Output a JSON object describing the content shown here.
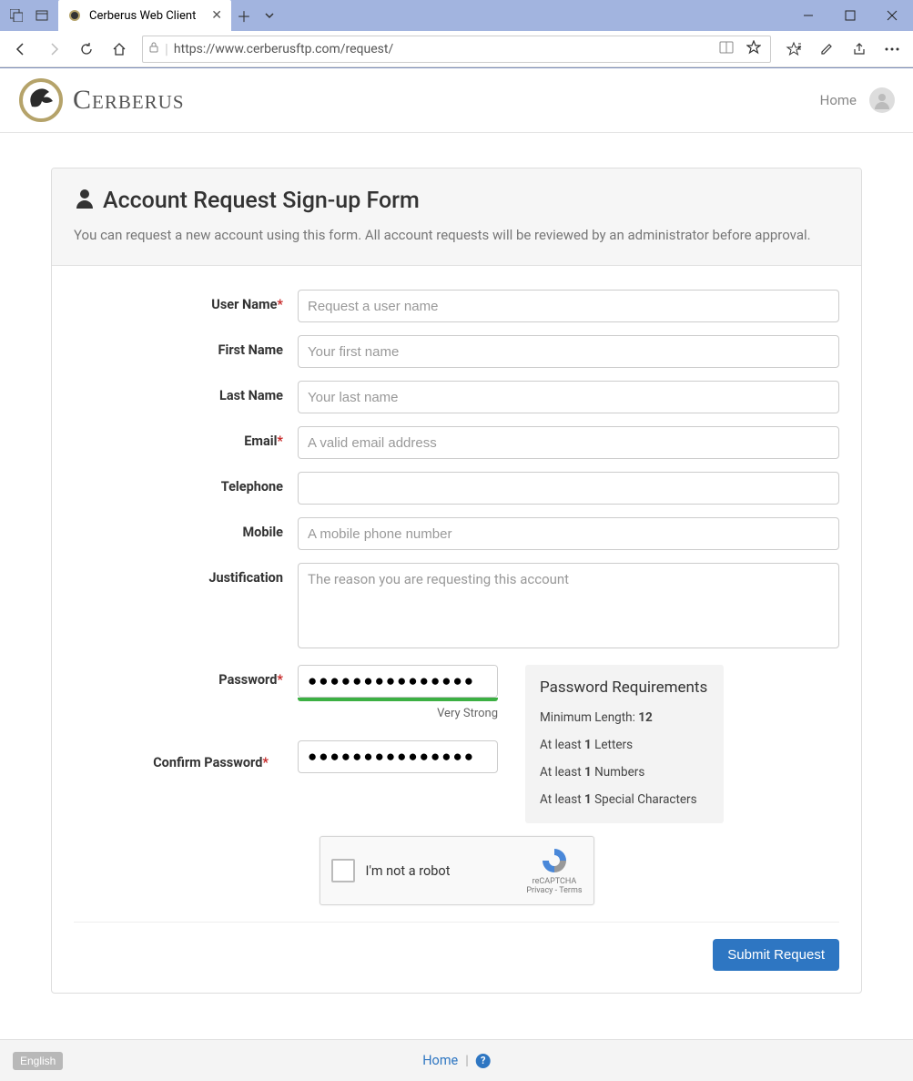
{
  "browser": {
    "tab_title": "Cerberus Web Client",
    "url": "https://www.cerberusftp.com/request/"
  },
  "header": {
    "brand": "Cerberus",
    "home_link": "Home"
  },
  "panel": {
    "title": "Account Request Sign-up Form",
    "description": "You can request a new account using this form. All account requests will be reviewed by an administrator before approval."
  },
  "form": {
    "username": {
      "label": "User Name",
      "required": true,
      "placeholder": "Request a user name",
      "value": ""
    },
    "firstname": {
      "label": "First Name",
      "required": false,
      "placeholder": "Your first name",
      "value": ""
    },
    "lastname": {
      "label": "Last Name",
      "required": false,
      "placeholder": "Your last name",
      "value": ""
    },
    "email": {
      "label": "Email",
      "required": true,
      "placeholder": "A valid email address",
      "value": ""
    },
    "telephone": {
      "label": "Telephone",
      "required": false,
      "placeholder": "",
      "value": ""
    },
    "mobile": {
      "label": "Mobile",
      "required": false,
      "placeholder": "A mobile phone number",
      "value": ""
    },
    "justification": {
      "label": "Justification",
      "required": false,
      "placeholder": "The reason you are requesting this account",
      "value": ""
    },
    "password": {
      "label": "Password",
      "required": true,
      "value": "●●●●●●●●●●●●●●●",
      "strength": "Very Strong"
    },
    "confirm": {
      "label": "Confirm Password",
      "required": true,
      "value": "●●●●●●●●●●●●●●●"
    }
  },
  "requirements": {
    "title": "Password Requirements",
    "min_label": "Minimum Length:",
    "min_value": "12",
    "r1_pre": "At least",
    "r1_b": "1",
    "r1_post": "Letters",
    "r2_pre": "At least",
    "r2_b": "1",
    "r2_post": "Numbers",
    "r3_pre": "At least",
    "r3_b": "1",
    "r3_post": "Special Characters"
  },
  "captcha": {
    "label": "I'm not a robot",
    "brand": "reCAPTCHA",
    "links": "Privacy  -  Terms"
  },
  "submit_label": "Submit Request",
  "footer": {
    "language": "English",
    "home": "Home"
  }
}
